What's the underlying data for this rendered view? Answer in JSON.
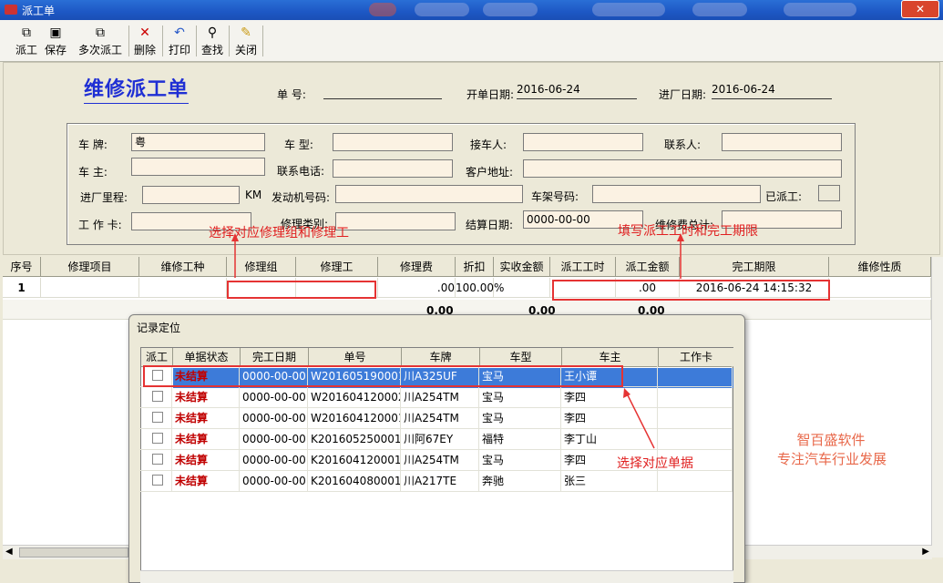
{
  "window": {
    "title": "派工单",
    "close": "✕"
  },
  "toolbar": {
    "buttons": [
      {
        "label": "派工",
        "icon": "dispatch-icon",
        "glyph": "⧉"
      },
      {
        "label": "保存",
        "icon": "save-icon",
        "glyph": "▣"
      },
      {
        "label": "多次派工",
        "icon": "multi-dispatch-icon",
        "glyph": "⧉"
      },
      {
        "label": "删除",
        "icon": "delete-icon",
        "glyph": "✕"
      },
      {
        "label": "打印",
        "icon": "print-icon",
        "glyph": "↶"
      },
      {
        "label": "查找",
        "icon": "find-icon",
        "glyph": "⚲"
      },
      {
        "label": "关闭",
        "icon": "close-icon",
        "glyph": "✎"
      }
    ]
  },
  "form": {
    "title": "维修派工单",
    "order_no_label": "单 号:",
    "order_no": "",
    "open_date_label": "开单日期:",
    "open_date": "2016-06-24",
    "enter_date_label": "进厂日期:",
    "enter_date": "2016-06-24"
  },
  "vehicle": {
    "plate_label": "车 牌:",
    "plate": "粤",
    "model_label": "车 型:",
    "model": "",
    "receiver_label": "接车人:",
    "receiver": "",
    "contact_label": "联系人:",
    "contact": "",
    "owner_label": "车 主:",
    "owner": "",
    "phone_label": "联系电话:",
    "phone": "",
    "address_label": "客户地址:",
    "address": "",
    "mileage_label": "进厂里程:",
    "mileage": "",
    "mileage_unit": "KM",
    "engine_label": "发动机号码:",
    "engine": "",
    "vin_label": "车架号码:",
    "vin": "",
    "dispatched_label": "已派工:",
    "card_label": "工 作 卡:",
    "card": "",
    "repair_type_label": "修理类别:",
    "repair_type": "",
    "settle_date_label": "结算日期:",
    "settle_date": "0000-00-00",
    "repair_total_label": "维修费总计:",
    "repair_total": ""
  },
  "annotations": {
    "group_tip": "选择对应修理组和修理工",
    "hours_tip": "填写派工工时和完工期限",
    "select_tip": "选择对应单据"
  },
  "main_grid": {
    "headers": [
      "序号",
      "修理项目",
      "维修工种",
      "修理组",
      "修理工",
      "修理费",
      "折扣",
      "实收金额",
      "派工工时",
      "派工金额",
      "完工期限",
      "维修性质"
    ],
    "row": {
      "seq": "1",
      "fee": ".00",
      "discount": "100.00%",
      "amount": ".00",
      "deadline": "2016-06-24 14:15:32"
    },
    "totals": {
      "fee": "0.00",
      "amount": "0.00",
      "dispatch_amount": "0.00"
    }
  },
  "dialog": {
    "title": "记录定位",
    "headers": [
      "派工",
      "单据状态",
      "完工日期",
      "单号",
      "车牌",
      "车型",
      "车主",
      "工作卡"
    ],
    "rows": [
      {
        "status": "未结算",
        "date": "0000-00-00",
        "no": "W201605190001",
        "plate": "川A325UF",
        "model": "宝马",
        "owner": "王小谭"
      },
      {
        "status": "未结算",
        "date": "0000-00-00",
        "no": "W201604120002",
        "plate": "川A254TM",
        "model": "宝马",
        "owner": "李四"
      },
      {
        "status": "未结算",
        "date": "0000-00-00",
        "no": "W201604120001",
        "plate": "川A254TM",
        "model": "宝马",
        "owner": "李四"
      },
      {
        "status": "未结算",
        "date": "0000-00-00",
        "no": "K201605250001",
        "plate": "川阿67EY",
        "model": "福特",
        "owner": "李丁山"
      },
      {
        "status": "未结算",
        "date": "0000-00-00",
        "no": "K201604120001",
        "plate": "川A254TM",
        "model": "宝马",
        "owner": "李四"
      },
      {
        "status": "未结算",
        "date": "0000-00-00",
        "no": "K201604080001",
        "plate": "川A217TE",
        "model": "奔驰",
        "owner": "张三"
      }
    ]
  },
  "watermark": {
    "line1": "智百盛软件",
    "line2": "专注汽车行业发展"
  },
  "colors": {
    "title_blue": "#1f2fd4",
    "annotation_red": "#e02020",
    "selection": "#3d7bd9",
    "status_red": "#c00000"
  }
}
